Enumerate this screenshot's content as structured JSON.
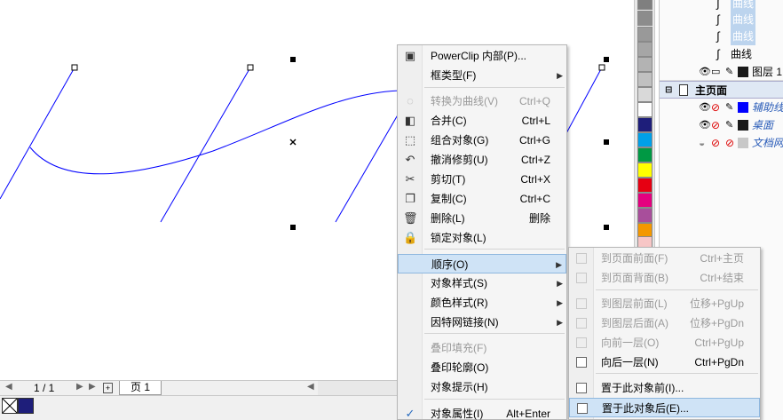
{
  "context_menu": {
    "items": [
      {
        "label": "PowerClip 内部(P)...",
        "shortcut": "",
        "submenu": false,
        "disabled": false,
        "icon": "powerclip-icon"
      },
      {
        "label": "框类型(F)",
        "shortcut": "",
        "submenu": true,
        "disabled": false,
        "icon": ""
      },
      {
        "label": "转换为曲线(V)",
        "shortcut": "Ctrl+Q",
        "submenu": false,
        "disabled": true,
        "icon": "convert-curve-icon"
      },
      {
        "label": "合并(C)",
        "shortcut": "Ctrl+L",
        "submenu": false,
        "disabled": false,
        "icon": "combine-icon"
      },
      {
        "label": "组合对象(G)",
        "shortcut": "Ctrl+G",
        "submenu": false,
        "disabled": false,
        "icon": "group-icon"
      },
      {
        "label": "撤消修剪(U)",
        "shortcut": "Ctrl+Z",
        "submenu": false,
        "disabled": false,
        "icon": "undo-icon"
      },
      {
        "label": "剪切(T)",
        "shortcut": "Ctrl+X",
        "submenu": false,
        "disabled": false,
        "icon": "cut-icon"
      },
      {
        "label": "复制(C)",
        "shortcut": "Ctrl+C",
        "submenu": false,
        "disabled": false,
        "icon": "copy-icon"
      },
      {
        "label": "删除(L)",
        "shortcut": "删除",
        "submenu": false,
        "disabled": false,
        "icon": "delete-icon"
      },
      {
        "label": "锁定对象(L)",
        "shortcut": "",
        "submenu": false,
        "disabled": false,
        "icon": "lock-icon"
      },
      {
        "label": "顺序(O)",
        "shortcut": "",
        "submenu": true,
        "disabled": false,
        "icon": ""
      },
      {
        "label": "对象样式(S)",
        "shortcut": "",
        "submenu": true,
        "disabled": false,
        "icon": ""
      },
      {
        "label": "颜色样式(R)",
        "shortcut": "",
        "submenu": true,
        "disabled": false,
        "icon": ""
      },
      {
        "label": "因特网链接(N)",
        "shortcut": "",
        "submenu": true,
        "disabled": false,
        "icon": ""
      },
      {
        "label": "叠印填充(F)",
        "shortcut": "",
        "submenu": false,
        "disabled": true,
        "icon": ""
      },
      {
        "label": "叠印轮廓(O)",
        "shortcut": "",
        "submenu": false,
        "disabled": false,
        "icon": ""
      },
      {
        "label": "对象提示(H)",
        "shortcut": "",
        "submenu": false,
        "disabled": false,
        "icon": ""
      },
      {
        "label": "对象属性(I)",
        "shortcut": "Alt+Enter",
        "submenu": false,
        "disabled": false,
        "icon": "checkmark-icon"
      }
    ]
  },
  "order_submenu": {
    "items": [
      {
        "label": "到页面前面(F)",
        "shortcut": "Ctrl+主页",
        "disabled": true
      },
      {
        "label": "到页面背面(B)",
        "shortcut": "Ctrl+结束",
        "disabled": true
      },
      {
        "label": "到图层前面(L)",
        "shortcut": "位移+PgUp",
        "disabled": true
      },
      {
        "label": "到图层后面(A)",
        "shortcut": "位移+PgDn",
        "disabled": true
      },
      {
        "label": "向前一层(O)",
        "shortcut": "Ctrl+PgUp",
        "disabled": true
      },
      {
        "label": "向后一层(N)",
        "shortcut": "Ctrl+PgDn",
        "disabled": false
      },
      {
        "label": "置于此对象前(I)...",
        "shortcut": "",
        "disabled": false
      },
      {
        "label": "置于此对象后(E)...",
        "shortcut": "",
        "disabled": false
      }
    ]
  },
  "object_manager": {
    "curve_items": [
      "曲线",
      "曲线",
      "曲线",
      "曲线"
    ],
    "layer_label": "图层 1",
    "master_page_label": "主页面",
    "master_layers": [
      "辅助线",
      "桌面",
      "文档网格"
    ]
  },
  "page_nav": {
    "page_counter": "1 / 1",
    "page_tab": "页 1"
  },
  "palette_colors": [
    "#7f7f7f",
    "#8c8c8c",
    "#999999",
    "#a6a6a6",
    "#b3b3b3",
    "#c0c0c0",
    "#d9d9d9",
    "#ffffff",
    "#1e1e7a",
    "#00a0e9",
    "#009944",
    "#ffff00",
    "#e60012",
    "#e4007f",
    "#a84e9b",
    "#f39800",
    "#f7c6c6"
  ],
  "colors": {
    "accent_blue": "#0000ff",
    "highlight": "#cfe3f6",
    "fill_indicator": "#1e1e7a"
  }
}
